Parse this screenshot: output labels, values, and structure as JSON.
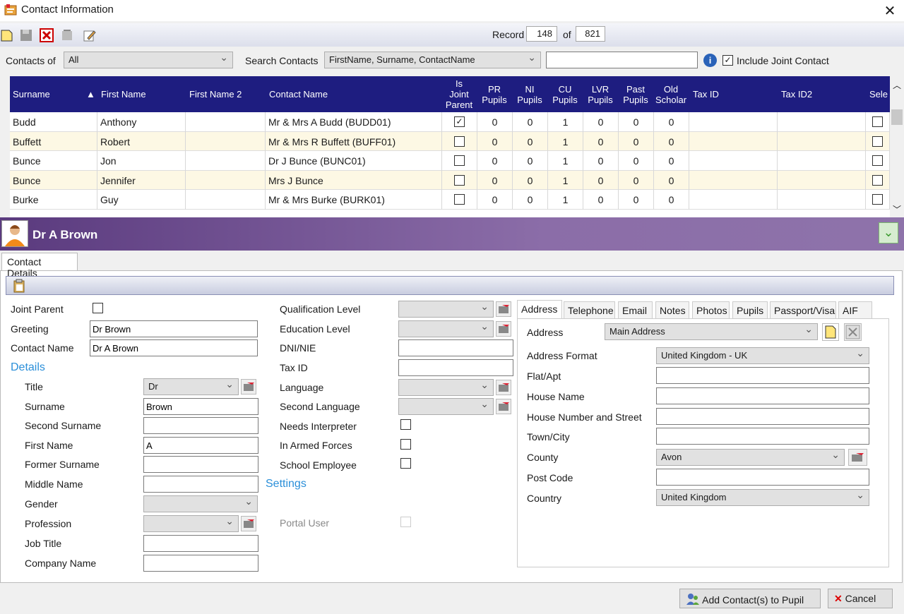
{
  "window": {
    "title": "Contact Information"
  },
  "record": {
    "label": "Record",
    "current": "148",
    "of_label": "of",
    "total": "821"
  },
  "filters": {
    "contacts_of_label": "Contacts of",
    "contacts_of_value": "All",
    "search_label": "Search Contacts",
    "search_fields_value": "FirstName, Surname, ContactName",
    "search_text": "",
    "include_joint_label": "Include Joint Contact",
    "include_joint_checked": true
  },
  "grid": {
    "columns": [
      "Surname",
      "First Name",
      "First Name 2",
      "Contact Name",
      "Is Joint Parent",
      "PR Pupils",
      "NI Pupils",
      "CU Pupils",
      "LVR Pupils",
      "Past Pupils",
      "Old Scholar",
      "Tax ID",
      "Tax ID2",
      "Sele"
    ],
    "column_lines": {
      "is_joint": [
        "Is",
        "Joint",
        "Parent"
      ],
      "pr": [
        "PR",
        "Pupils"
      ],
      "ni": [
        "NI",
        "Pupils"
      ],
      "cu": [
        "CU",
        "Pupils"
      ],
      "lvr": [
        "LVR",
        "Pupils"
      ],
      "past": [
        "Past",
        "Pupils"
      ],
      "old": [
        "Old",
        "Scholar"
      ]
    },
    "rows": [
      {
        "surname": "Budd",
        "first": "Anthony",
        "first2": "",
        "contact": "Mr & Mrs A Budd (BUDD01)",
        "joint": true,
        "pr": "0",
        "ni": "0",
        "cu": "1",
        "lvr": "0",
        "past": "0",
        "old": "0"
      },
      {
        "surname": "Buffett",
        "first": "Robert",
        "first2": "",
        "contact": "Mr & Mrs R Buffett (BUFF01)",
        "joint": false,
        "pr": "0",
        "ni": "0",
        "cu": "1",
        "lvr": "0",
        "past": "0",
        "old": "0"
      },
      {
        "surname": "Bunce",
        "first": "Jon",
        "first2": "",
        "contact": "Dr J Bunce (BUNC01)",
        "joint": false,
        "pr": "0",
        "ni": "0",
        "cu": "1",
        "lvr": "0",
        "past": "0",
        "old": "0"
      },
      {
        "surname": "Bunce",
        "first": "Jennifer",
        "first2": "",
        "contact": "Mrs J Bunce",
        "joint": false,
        "pr": "0",
        "ni": "0",
        "cu": "1",
        "lvr": "0",
        "past": "0",
        "old": "0"
      },
      {
        "surname": "Burke",
        "first": "Guy",
        "first2": "",
        "contact": "Mr & Mrs  Burke (BURK01)",
        "joint": false,
        "pr": "0",
        "ni": "0",
        "cu": "1",
        "lvr": "0",
        "past": "0",
        "old": "0"
      }
    ]
  },
  "banner": {
    "name": "Dr A Brown"
  },
  "tab": {
    "label": "Contact Details"
  },
  "form": {
    "joint_parent_label": "Joint Parent",
    "greeting_label": "Greeting",
    "greeting_value": "Dr Brown",
    "contact_name_label": "Contact Name",
    "contact_name_value": "Dr A Brown",
    "details_label": "Details",
    "title_label": "Title",
    "title_value": "Dr",
    "surname_label": "Surname",
    "surname_value": "Brown",
    "second_surname_label": "Second Surname",
    "first_name_label": "First Name",
    "first_name_value": "A",
    "former_surname_label": "Former Surname",
    "middle_name_label": "Middle Name",
    "gender_label": "Gender",
    "profession_label": "Profession",
    "job_title_label": "Job Title",
    "company_name_label": "Company Name",
    "qualification_label": "Qualification Level",
    "education_label": "Education Level",
    "dni_label": "DNI/NIE",
    "taxid_label": "Tax ID",
    "language_label": "Language",
    "second_language_label": "Second Language",
    "needs_interpreter_label": "Needs Interpreter",
    "armed_forces_label": "In Armed Forces",
    "school_employee_label": "School Employee",
    "settings_label": "Settings",
    "portal_user_label": "Portal User"
  },
  "address_tabs": [
    "Address",
    "Telephone",
    "Email",
    "Notes",
    "Photos",
    "Pupils",
    "Passport/Visa",
    "AIF"
  ],
  "address": {
    "address_label": "Address",
    "address_value": "Main Address",
    "format_label": "Address Format",
    "format_value": "United Kingdom - UK",
    "flat_label": "Flat/Apt",
    "house_name_label": "House Name",
    "house_number_label": "House Number and Street",
    "town_label": "Town/City",
    "county_label": "County",
    "county_value": "Avon",
    "postcode_label": "Post Code",
    "country_label": "Country",
    "country_value": "United Kingdom"
  },
  "footer": {
    "add_label": "Add Contact(s) to Pupil",
    "cancel_label": "Cancel"
  },
  "colors": {
    "grid_header": "#1e1d80",
    "row_alt": "#fdf8e4",
    "banner": "#7a5a9a",
    "section": "#2b8fd9"
  }
}
